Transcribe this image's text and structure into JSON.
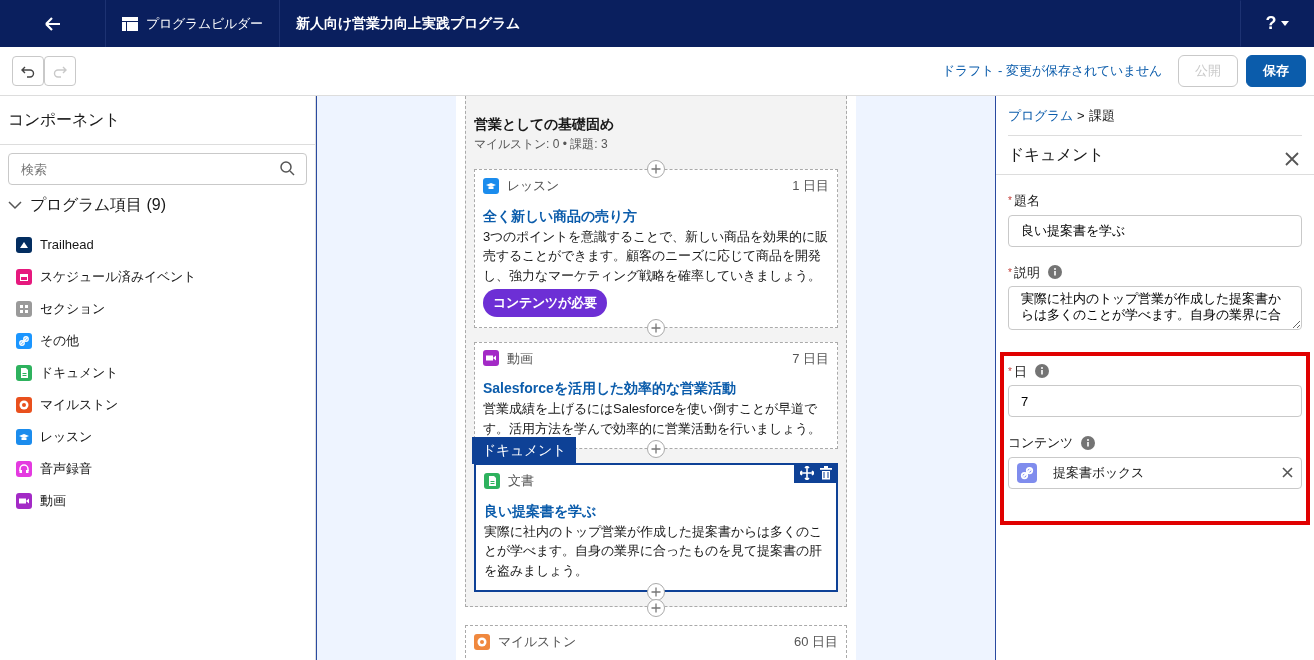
{
  "header": {
    "app_name": "プログラムビルダー",
    "title": "新人向け営業力向上実践プログラム",
    "help": "?"
  },
  "toolbar": {
    "undo_disabled": false,
    "redo_disabled": true,
    "status": "ドラフト - 変更が保存されていません",
    "buttons": [
      {
        "label": "公開",
        "kind": "neutral",
        "disabled": true
      },
      {
        "label": "保存",
        "kind": "brand",
        "disabled": false
      }
    ]
  },
  "sidebar": {
    "title": "コンポーネント",
    "search": {
      "placeholder": "検索"
    },
    "group": {
      "label": "プログラム項目 (9)",
      "expanded": true,
      "items": [
        {
          "label": "Trailhead",
          "kind": "trailhead",
          "color": "#032d60"
        },
        {
          "label": "スケジュール済みイベント",
          "kind": "event",
          "color": "#e6197e"
        },
        {
          "label": "セクション",
          "kind": "section",
          "color": "#9a9a9a"
        },
        {
          "label": "その他",
          "kind": "link",
          "color": "#1b96ff"
        },
        {
          "label": "ドキュメント",
          "kind": "document",
          "color": "#2eb25e"
        },
        {
          "label": "マイルストン",
          "kind": "milestone",
          "color": "#e9501d"
        },
        {
          "label": "レッスン",
          "kind": "lesson",
          "color": "#1b8ced"
        },
        {
          "label": "音声録音",
          "kind": "audio",
          "color": "#e43ae0"
        },
        {
          "label": "動画",
          "kind": "video",
          "color": "#a32ac6"
        }
      ]
    }
  },
  "canvas": {
    "section": {
      "title": "営業としての基礎固め",
      "meta": "マイルストン: 0 • 課題: 3",
      "cards": [
        {
          "kind": "lesson",
          "color": "#1b8ced",
          "type": "レッスン",
          "day": "1 日目",
          "title": "全く新しい商品の売り方",
          "description": "3つのポイントを意識することで、新しい商品を効果的に販売することができます。顧客のニーズに応じて商品を開発し、強力なマーケティング戦略を確率していきましょう。",
          "badge": "コンテンツが必要",
          "selected": false
        },
        {
          "kind": "video",
          "color": "#a32ac6",
          "type": "動画",
          "day": "7 日目",
          "title": "Salesforceを活用した効率的な営業活動",
          "description": "営業成績を上げるにはSalesforceを使い倒すことが早道です。活用方法を学んで効率的に営業活動を行いましょう。",
          "selected": false
        },
        {
          "kind": "document",
          "color": "#2eb25e",
          "type": "文書",
          "tag": "ドキュメント",
          "title": "良い提案書を学ぶ",
          "description": "実際に社内のトップ営業が作成した提案書からは多くのことが学べます。自身の業界に合ったものを見て提案書の肝を盗みましょう。",
          "selected": true
        }
      ]
    },
    "cards_after": [
      {
        "kind": "milestone",
        "color": "#f0883e",
        "type": "マイルストン",
        "day": "60 日目",
        "selected": false
      }
    ]
  },
  "details": {
    "breadcrumb": [
      {
        "label": "プログラム",
        "link": true
      },
      {
        "label": "課題",
        "link": false
      }
    ],
    "separator": ">",
    "title": "ドキュメント",
    "required_mark": "*",
    "fields": [
      {
        "kind": "text",
        "label": "題名",
        "required": true,
        "info": false,
        "value": "良い提案書を学ぶ",
        "highlighted": false
      },
      {
        "kind": "textarea",
        "label": "説明",
        "required": true,
        "info": true,
        "value": "実際に社内のトップ営業が作成した提案書からは多くのことが学べます。自身の業界に合",
        "highlighted": false
      },
      {
        "kind": "text",
        "label": "日",
        "required": true,
        "info": true,
        "value": "7",
        "highlighted": true
      },
      {
        "kind": "lookup",
        "label": "コンテンツ",
        "required": false,
        "info": true,
        "value": "提案書ボックス",
        "highlighted": true
      }
    ]
  }
}
